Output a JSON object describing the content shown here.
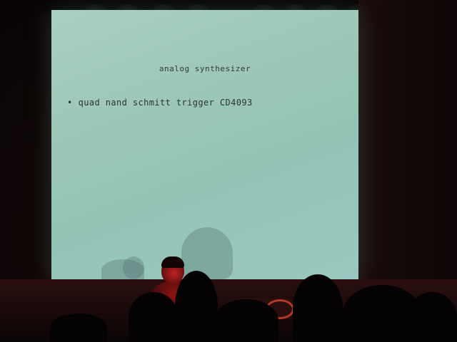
{
  "slide": {
    "title": "analog synthesizer",
    "bullets": [
      {
        "marker": "•",
        "text": "quad nand schmitt trigger CD4093"
      }
    ]
  },
  "colors": {
    "screen": "#9ec8b8",
    "slide_text": "#2f3b38",
    "stage_light": "#c02222",
    "background": "#0a0606"
  }
}
